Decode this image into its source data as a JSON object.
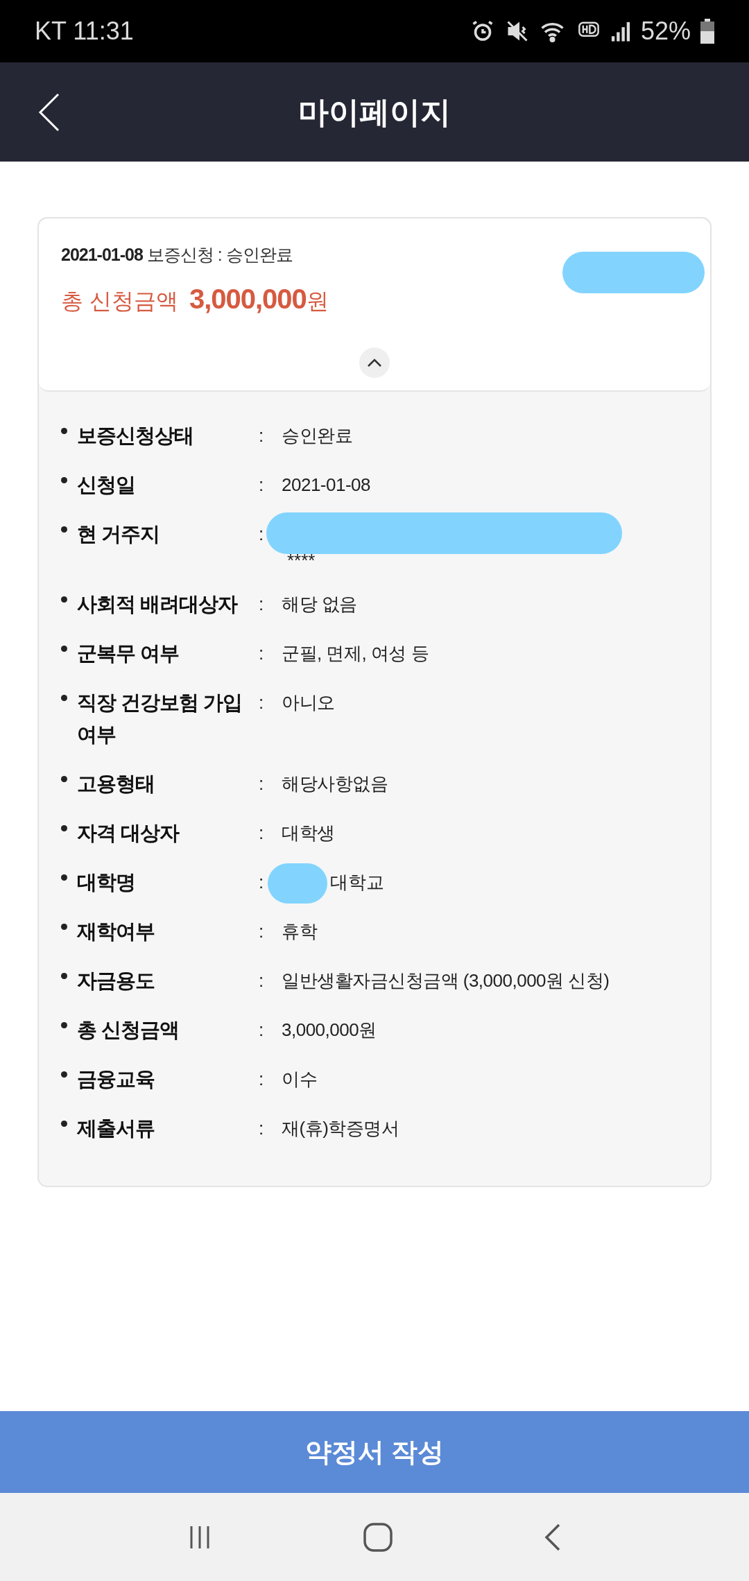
{
  "status_bar": {
    "carrier_time": "KT 11:31",
    "battery": "52%"
  },
  "header": {
    "title": "마이페이지"
  },
  "summary": {
    "line": "**2021-01-08** 보증신청 : 승인완료",
    "amount_label": "총 신청금액",
    "amount": "3,000,000",
    "currency": "원",
    "redacted": true,
    "expanded": true
  },
  "details": [
    {
      "label": "보증신청상태",
      "separator": ":",
      "value": "승인완료"
    },
    {
      "label": "신청일",
      "separator": ":",
      "value": "2021-01-08"
    },
    {
      "label": "현 거주지",
      "separator": ":",
      "value": "****",
      "redacted": true
    },
    {
      "label": "사회적 배려대상자",
      "separator": ":",
      "value": "해당 없음"
    },
    {
      "label": "군복무 여부",
      "separator": ":",
      "value": "군필, 면제, 여성 등"
    },
    {
      "label": "직장 건강보험 가입 여부",
      "separator": ":",
      "value": "아니오"
    },
    {
      "label": "고용형태",
      "separator": ":",
      "value": "해당사항없음"
    },
    {
      "label": "자격 대상자",
      "separator": ":",
      "value": "대학생"
    },
    {
      "label": "대학명",
      "separator": ":",
      "value": "대학교",
      "redacted": true
    },
    {
      "label": "재학여부",
      "separator": ":",
      "value": "휴학"
    },
    {
      "label": "자금용도",
      "separator": ":",
      "value": "일반생활자금신청금액 (3,000,000원 신청)"
    },
    {
      "label": "총 신청금액",
      "separator": ":",
      "value": "3,000,000원"
    },
    {
      "label": "금융교육",
      "separator": ":",
      "value": "이수"
    },
    {
      "label": "제출서류",
      "separator": ":",
      "value": "재(휴)학증명서"
    }
  ],
  "bottom_button": "약정서 작성"
}
